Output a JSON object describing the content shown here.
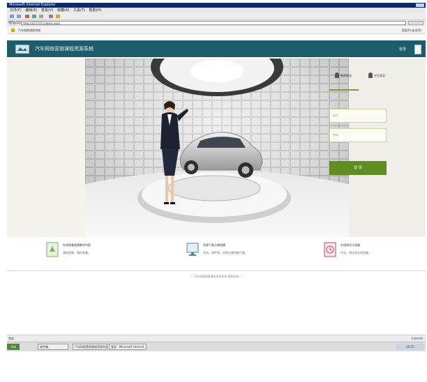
{
  "browser": {
    "title": "Microsoft Internet Explorer",
    "menu": [
      "文件(F)",
      "编辑(E)",
      "查看(V)",
      "收藏(A)",
      "工具(T)",
      "帮助(H)"
    ],
    "address_label": "地址(D)",
    "address": "http://127.0.0.1/login.aspx",
    "favorites_link": "汽车销售课程系统",
    "page_menu": "页面(P) 安全(S)"
  },
  "site": {
    "title": "汽车网络营销课程资源系统",
    "user_link": "登录"
  },
  "login": {
    "tabs": [
      {
        "label": "教师登录",
        "icon": "teacher-icon"
      },
      {
        "label": "学生登录",
        "icon": "student-icon"
      }
    ],
    "username_placeholder": "账号",
    "password_placeholder": "密码",
    "submit_label": "登 录",
    "accent": "#5f8d22"
  },
  "features": [
    {
      "title": "在线观看视频教学内容",
      "desc": "课程视频，随时观看。",
      "icon": "video-icon",
      "color": "#7ab06b"
    },
    {
      "title": "资源下载方便快捷",
      "desc": "文档、课件等，资源方便快捷下载。",
      "icon": "monitor-icon",
      "color": "#4a86b8"
    },
    {
      "title": "在线测试与答疑",
      "desc": "作业、测试及在线答疑。",
      "icon": "clock-icon",
      "color": "#c34a6a"
    }
  ],
  "footer": {
    "copyright": "— 汽车网络营销课程资源系统 版权所有 —"
  },
  "statusbar": {
    "left": "完成",
    "right": "Internet"
  },
  "taskbar": {
    "start": "开始",
    "items": [
      "收件箱",
      "汽车网络营销课程资源系统",
      "登录 - Microsoft Internet..."
    ],
    "clock": "10:25"
  },
  "colors": {
    "header": "#1c5c6b",
    "button": "#5f8d22"
  }
}
